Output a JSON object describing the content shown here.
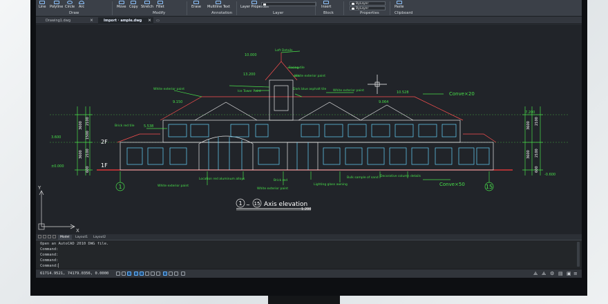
{
  "ribbon": {
    "draw_tools": [
      "Line",
      "Polyline",
      "Circle",
      "Arc"
    ],
    "modify_tools": [
      "Move",
      "Copy",
      "Stretch",
      "Fillet"
    ],
    "annotation_tools": [
      "Erase",
      "Multiline Text"
    ],
    "layer_properties_label": "Layer Properties",
    "insert_label": "Insert",
    "paste_label": "Paste",
    "bylayer_1": "ByLayer",
    "bylayer_2": "ByLayer",
    "groups": {
      "draw": "Draw",
      "modify": "Modify",
      "annotation": "Annotation",
      "layer": "Layer",
      "block": "Block",
      "properties": "Properties",
      "clipboard": "Clipboard"
    }
  },
  "tabs": [
    {
      "label": "Drawing1.dwg"
    },
    {
      "label": "Import · ample.dwg"
    }
  ],
  "drawing": {
    "title": "1 ~ 15 Axis elevation",
    "title_axis_start": "1",
    "title_axis_end": "15",
    "title_text": "Axis elevation",
    "scale": "1:200",
    "axis_left": "1",
    "axis_right": "15",
    "ucs_x": "X",
    "ucs_y": "Y",
    "floor_labels": [
      "2F",
      "1F"
    ],
    "level_tags": [
      "10.000",
      "13.200",
      "9.150",
      "5.538",
      "10.528",
      "9.064",
      "7.200",
      "3.600",
      "±0.000",
      "-0.600"
    ],
    "dim_left": [
      "3600",
      "2100",
      "1500",
      "3600",
      "2100",
      "600"
    ],
    "dim_right": [
      "3600",
      "2100",
      "3600",
      "2100",
      "600"
    ],
    "annotations": [
      "Loft Details",
      "Facing tile",
      "White exterior paint",
      "Dark blue asphalt tile",
      "Ice Tower Paint",
      "White exterior paint",
      "Brick red tile",
      "Conve×20",
      "Conve×50",
      "Location red aluminum alloys",
      "White exterior paint",
      "Brick red",
      "White exterior paint",
      "Lighting glass awning",
      "Bulk sample of sand",
      "Decorative column details",
      "White exterior paint"
    ]
  },
  "layout_tabs": [
    "Model",
    "Layout1",
    "Layout2"
  ],
  "command": {
    "lines": [
      "Open an AutoCAD 2010 DWG file.",
      "Command:",
      "Command:",
      "Command:"
    ],
    "prompt": "Command:"
  },
  "status": {
    "coords": "61714.9521, 74179.0356, 0.0000"
  }
}
